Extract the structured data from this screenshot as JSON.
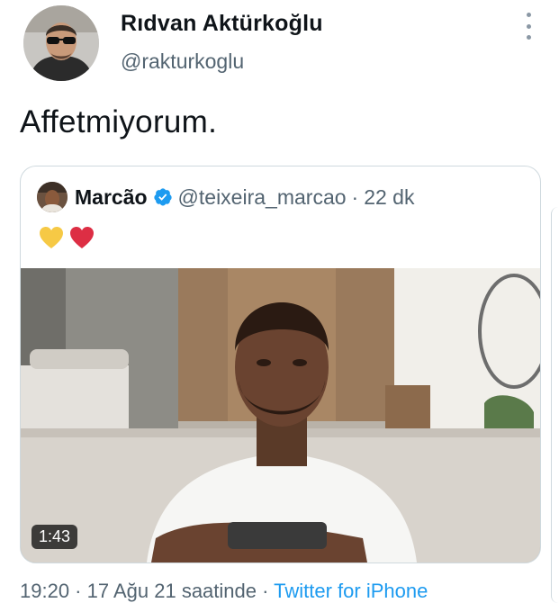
{
  "tweet": {
    "author": {
      "name": "Rıdvan Aktürkoğlu",
      "handle": "@rakturkoglu",
      "avatar_icon": "profile-photo-avatar"
    },
    "text": "Affetmiyorum.",
    "more_icon": "vertical-ellipsis-icon",
    "quoted": {
      "name": "Marcão",
      "verified_icon": "verified-badge-icon",
      "handle": "@teixeira_marcao",
      "separator": "·",
      "time": "22 dk",
      "emojis": [
        "yellow-heart",
        "red-heart"
      ],
      "video": {
        "duration": "1:43"
      }
    },
    "timestamp": "19:20 · 17 Ağu 21 saatinde ·",
    "source": "Twitter for iPhone"
  },
  "colors": {
    "text": "#0f1419",
    "secondary": "#536471",
    "link": "#1d9bf0",
    "border": "#cfd9de"
  }
}
